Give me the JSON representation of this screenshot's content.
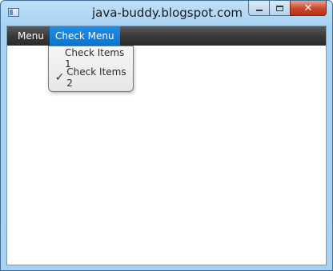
{
  "window": {
    "title": "java-buddy.blogspot.com",
    "close_glyph": "✕"
  },
  "menubar": {
    "menus": [
      {
        "label": "Menu",
        "active": false
      },
      {
        "label": "Check Menu",
        "active": true
      }
    ]
  },
  "check_menu_popup": {
    "items": [
      {
        "label": "Check Items 1",
        "checked": false
      },
      {
        "label": "Check Items 2",
        "checked": true,
        "check_glyph": "✓"
      }
    ]
  },
  "colors": {
    "titlebar": "#a9d3f3",
    "menubar": "#3a3a3a",
    "menu_active": "#0d74cf",
    "close_button": "#c9452c"
  }
}
